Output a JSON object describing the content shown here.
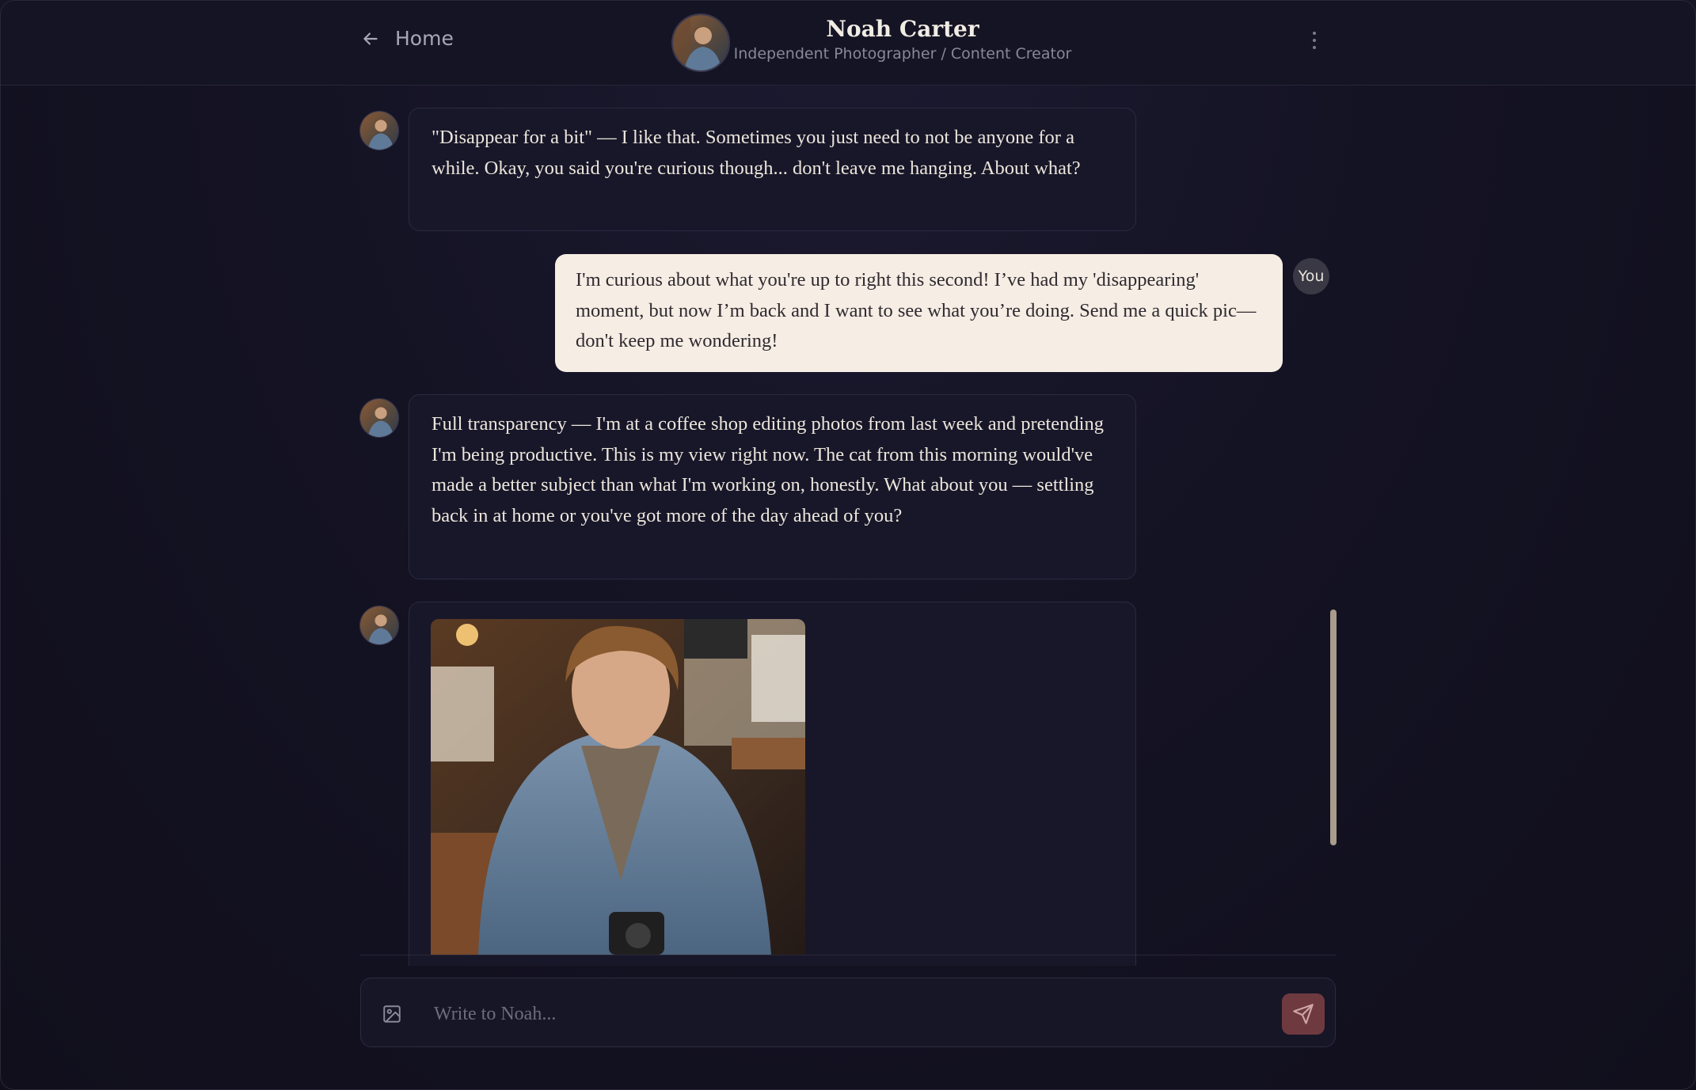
{
  "header": {
    "back_label": "Home",
    "name": "Noah Carter",
    "subtitle": "Independent Photographer / Content Creator"
  },
  "messages": [
    {
      "from": "bot",
      "text": "\"Disappear for a bit\" — I like that. Sometimes you just need to not be anyone for a while. Okay, you said you're curious though... don't leave me hanging. About what?"
    },
    {
      "from": "user",
      "text": "I'm curious about what you're up to right this second! I’ve had my 'disappearing' moment, but now I’m back and I want to see what you’re doing. Send me a quick pic—don't keep me wondering!"
    },
    {
      "from": "bot",
      "text": "Full transparency — I'm at a coffee shop editing photos from last week and pretending I'm being productive. This is my view right now. The cat from this morning would've made a better subject than what I'm working on, honestly. What about you — settling back in at home or you've got more of the day ahead of you?"
    },
    {
      "from": "bot",
      "type": "image"
    }
  ],
  "user_badge": "You",
  "composer": {
    "placeholder": "Write to Noah..."
  },
  "colors": {
    "background": "#141324",
    "user_bubble": "#f6ede4",
    "bot_bubble": "#181729",
    "send_button": "#6e3a40",
    "scrollbar": "#a99c8c"
  },
  "icons": {
    "back": "arrow-left-icon",
    "menu": "kebab-menu-icon",
    "attach": "image-icon",
    "send": "send-icon"
  }
}
